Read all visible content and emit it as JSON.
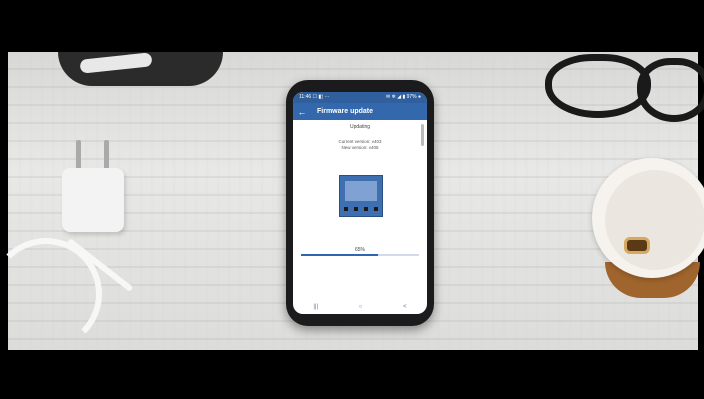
{
  "phone": {
    "statusbar": {
      "left": "11:46 ☐ ◧ ···",
      "right": "✉ ❄ ◢ ▮ 97% ●"
    },
    "appbar": {
      "back_icon": "←",
      "title": "Firmware update"
    },
    "status_label": "Updating",
    "current_version": "Current version: v403",
    "new_version": "New version: v405",
    "progress": {
      "label": "65%",
      "value": 0.65
    },
    "navbar": {
      "recent_icon": "|||",
      "home_icon": "○",
      "back_icon": "<"
    }
  },
  "colors": {
    "accent": "#3468ad",
    "statusbar": "#2f5f9c",
    "progress_fill": "#2f66b3"
  }
}
